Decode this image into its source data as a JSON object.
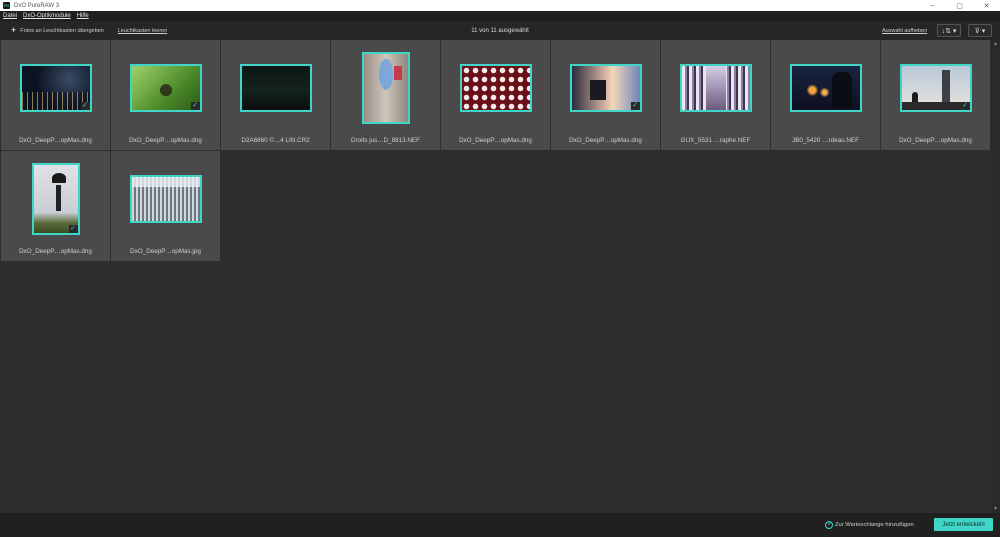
{
  "window": {
    "title": "DxO PureRAW 3",
    "logo": "PR",
    "minimize": "–",
    "maximize": "▢",
    "close": "✕"
  },
  "menu": [
    {
      "label": "Datei"
    },
    {
      "label": "DxO-Optikmodule"
    },
    {
      "label": "Hilfe"
    }
  ],
  "toolbar": {
    "add_icon": "+",
    "add_label": "Fotos an Leuchtkasten übergeben",
    "clear_label": "Leuchtkasten leeren",
    "selection_count": "11 von 11 ausgewählt",
    "deselect_label": "Auswahl aufheben",
    "sort_icon": "↓⇅ ▾",
    "filter_icon": "⊽ ▾"
  },
  "photos": [
    {
      "filename": "DxO_DeepP…opMas.dng",
      "checked": true
    },
    {
      "filename": "DxO_DeepP…opMas.dng",
      "checked": true
    },
    {
      "filename": "D2A6860 ©…4 LIN.CR2",
      "checked": false
    },
    {
      "filename": "Droits jus…D_8813.NEF",
      "checked": false
    },
    {
      "filename": "DxO_DeepP…opMas.dng",
      "checked": false
    },
    {
      "filename": "DxO_DeepP…opMas.dng",
      "checked": true
    },
    {
      "filename": "GUX_5531 …raphe.NEF",
      "checked": false
    },
    {
      "filename": "JB0_5420 …rdeau.NEF",
      "checked": false
    },
    {
      "filename": "DxO_DeepP…opMas.dng",
      "checked": true
    },
    {
      "filename": "DxO_DeepP…opMas.dng",
      "checked": true
    },
    {
      "filename": "DxO_DeepP…opMas.jpg",
      "checked": false
    }
  ],
  "check_glyph": "✓",
  "footer": {
    "queue_icon": "+",
    "queue_label": "Zur Warteschlange hinzufügen",
    "process_label": "Jetzt entwickeln"
  },
  "colors": {
    "accent": "#3fd6c8",
    "background": "#2d2d2d",
    "cell": "#4a4a4a"
  }
}
